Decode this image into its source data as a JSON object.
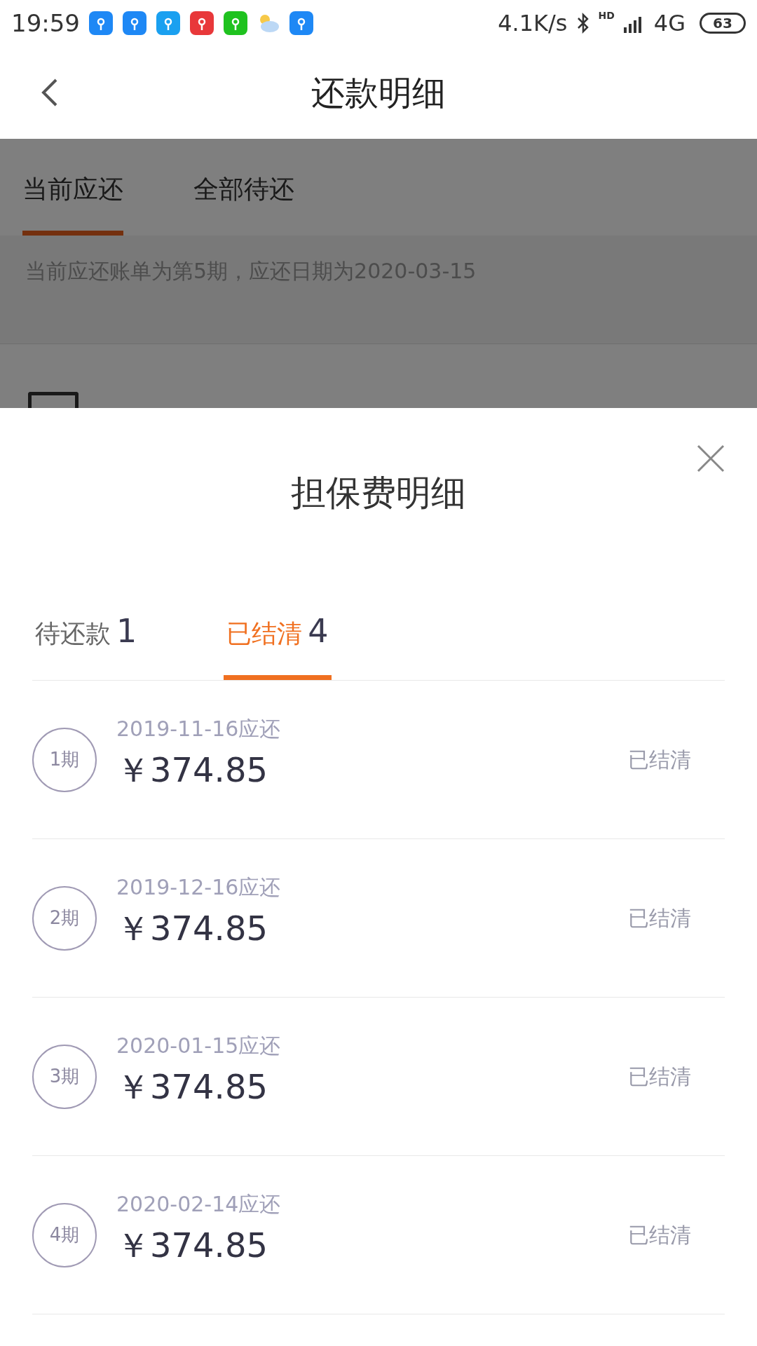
{
  "status_bar": {
    "time": "19:59",
    "speed": "4.1K/s",
    "hd": "HD",
    "network": "4G",
    "battery": "63"
  },
  "header": {
    "title": "还款明细"
  },
  "tabs": [
    {
      "label": "当前应还",
      "selected": true
    },
    {
      "label": "全部待还",
      "selected": false
    }
  ],
  "notice": "当前应还账单为第5期，应还日期为2020-03-15",
  "sheet": {
    "title": "担保费明细",
    "tabs": [
      {
        "label": "待还款",
        "count": "1",
        "selected": false
      },
      {
        "label": "已结清",
        "count": "4",
        "selected": true
      }
    ],
    "rows": [
      {
        "period": "1期",
        "date": "2019-11-16应还",
        "amount": "￥374.85",
        "status": "已结清"
      },
      {
        "period": "2期",
        "date": "2019-12-16应还",
        "amount": "￥374.85",
        "status": "已结清"
      },
      {
        "period": "3期",
        "date": "2020-01-15应还",
        "amount": "￥374.85",
        "status": "已结清"
      },
      {
        "period": "4期",
        "date": "2020-02-14应还",
        "amount": "￥374.85",
        "status": "已结清"
      }
    ]
  }
}
